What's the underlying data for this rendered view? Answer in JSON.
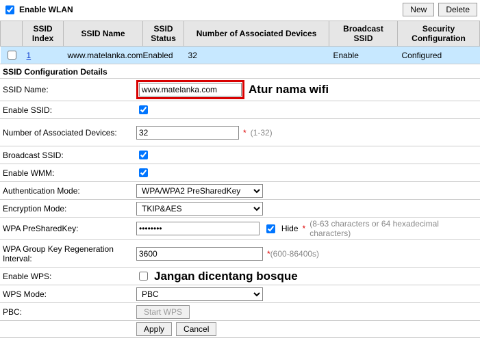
{
  "top": {
    "enable_wlan_label": "Enable WLAN",
    "enable_wlan_checked": true,
    "new_btn": "New",
    "delete_btn": "Delete"
  },
  "table": {
    "headers": {
      "ssid_index": "SSID Index",
      "ssid_name": "SSID Name",
      "ssid_status": "SSID Status",
      "num_assoc": "Number of Associated Devices",
      "broadcast": "Broadcast SSID",
      "security": "Security Configuration"
    },
    "row": {
      "index": "1",
      "name": "www.matelanka.com",
      "status": "Enabled",
      "num_assoc": "32",
      "broadcast": "Enable",
      "security": "Configured"
    }
  },
  "section_title": "SSID Configuration Details",
  "form": {
    "ssid_name_label": "SSID Name:",
    "ssid_name_value": "www.matelanka.com",
    "ssid_name_annot": "Atur nama wifi",
    "enable_ssid_label": "Enable SSID:",
    "num_assoc_label": "Number of Associated Devices:",
    "num_assoc_value": "32",
    "num_assoc_hint": "(1-32)",
    "broadcast_label": "Broadcast SSID:",
    "wmm_label": "Enable WMM:",
    "auth_mode_label": "Authentication Mode:",
    "auth_mode_value": "WPA/WPA2 PreSharedKey",
    "enc_mode_label": "Encryption Mode:",
    "enc_mode_value": "TKIP&AES",
    "psk_label": "WPA PreSharedKey:",
    "psk_value": "••••••••",
    "hide_label": "Hide",
    "psk_hint": "(8-63 characters or 64 hexadecimal characters)",
    "group_key_label": "WPA Group Key Regeneration Interval:",
    "group_key_value": "3600",
    "group_key_hint": "(600-86400s)",
    "enable_wps_label": "Enable WPS:",
    "enable_wps_annot": "Jangan dicentang bosque",
    "wps_mode_label": "WPS Mode:",
    "wps_mode_value": "PBC",
    "pbc_label": "PBC:",
    "start_wps_btn": "Start WPS",
    "apply_btn": "Apply",
    "cancel_btn": "Cancel"
  }
}
